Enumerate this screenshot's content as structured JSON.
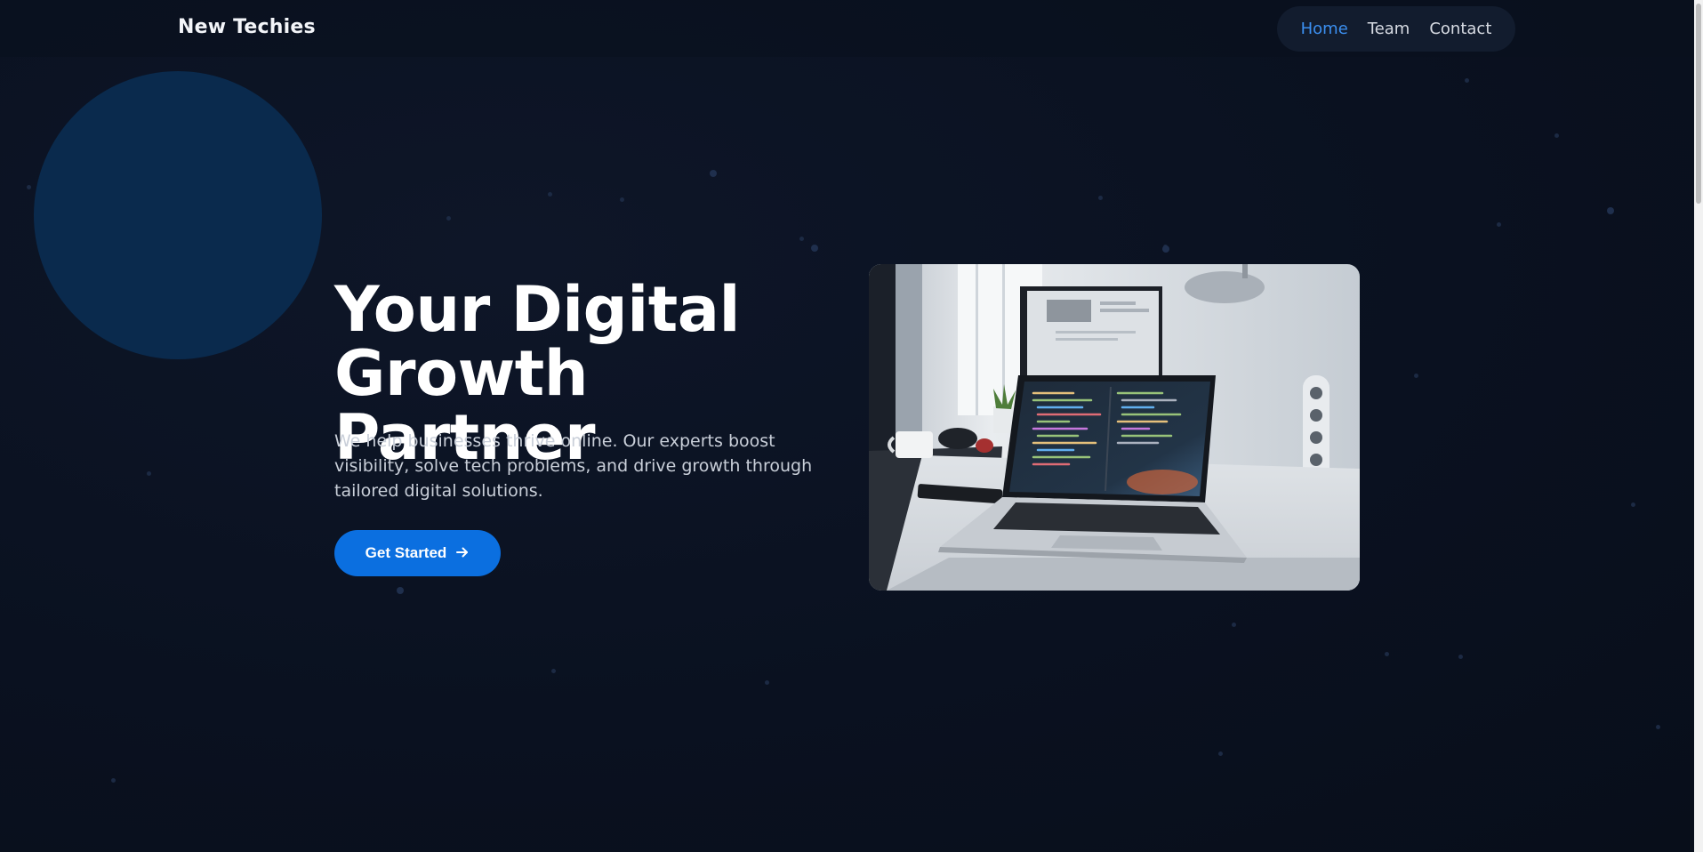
{
  "brand": {
    "name": "New Techies"
  },
  "nav": {
    "items": [
      {
        "label": "Home",
        "active": true
      },
      {
        "label": "Team",
        "active": false
      },
      {
        "label": "Contact",
        "active": false
      }
    ]
  },
  "hero": {
    "title_line1": "Your Digital",
    "title_line2": "Growth Partner",
    "description": "We help businesses thrive online. Our experts boost visibility, solve tech problems, and drive growth through tailored digital solutions.",
    "cta_label": "Get Started",
    "cta_icon": "arrow-right-icon",
    "image": "workspace-laptop-photo"
  },
  "colors": {
    "background": "#0b1120",
    "accent": "#0b6fe0",
    "nav_active": "#3b8ff0",
    "orb": "#0a2a4d"
  }
}
